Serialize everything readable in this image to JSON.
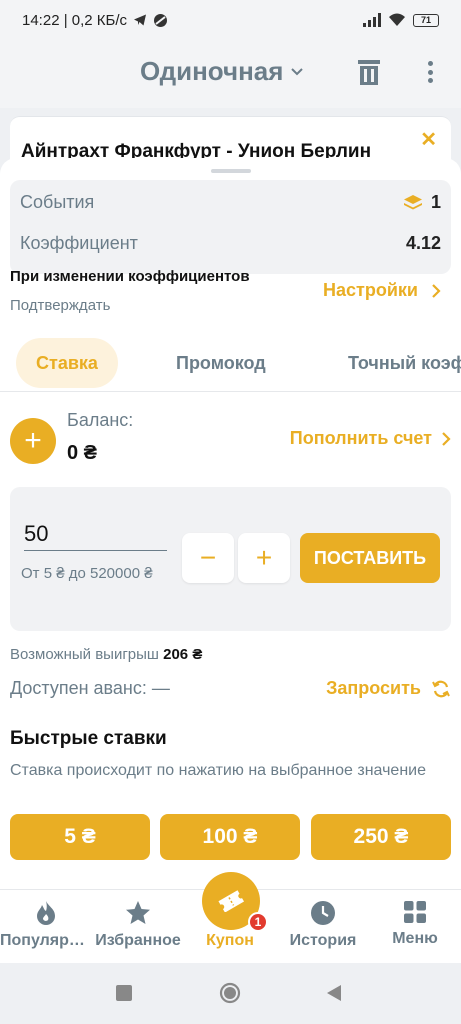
{
  "status_bar": {
    "time_speed": "14:22 | 0,2 КБ/с",
    "battery": "71"
  },
  "header": {
    "title": "Одиночная"
  },
  "match": {
    "title": "Айнтрахт Франкфурт - Унион Берлин"
  },
  "summary": {
    "events_label": "События",
    "events_value": "1",
    "coef_label": "Коэффициент",
    "coef_value": "4.12"
  },
  "odds_change": {
    "title": "При изменении коэффициентов",
    "mode": "Подтверждать",
    "settings_label": "Настройки"
  },
  "tabs": [
    {
      "label": "Ставка",
      "active": true
    },
    {
      "label": "Промокод",
      "active": false
    },
    {
      "label": "Точный коэффициент",
      "active": false
    }
  ],
  "balance": {
    "label": "Баланс:",
    "value": "0 ₴",
    "topup_label": "Пополнить счет"
  },
  "stake": {
    "amount": "50",
    "range": "От 5 ₴ до 520000 ₴",
    "minus": "−",
    "plus": "+",
    "place_label": "ПОСТАВИТЬ"
  },
  "possible_win": {
    "label": "Возможный выигрыш",
    "value": "206 ₴"
  },
  "advance": {
    "label": "Доступен аванс: —",
    "request_label": "Запросить"
  },
  "quick_bets": {
    "title": "Быстрые ставки",
    "subtitle": "Ставка происходит по нажатию на выбранное значение",
    "values": [
      "5 ₴",
      "100 ₴",
      "250 ₴"
    ]
  },
  "bottom_nav": {
    "items": [
      {
        "label": "Популярное",
        "icon": "fire-icon"
      },
      {
        "label": "Избранное",
        "icon": "star-icon"
      },
      {
        "label": "Купон",
        "icon": "ticket-icon",
        "active": true
      },
      {
        "label": "История",
        "icon": "clock-icon"
      },
      {
        "label": "Меню",
        "icon": "grid-icon"
      }
    ],
    "coupon_badge": "1"
  },
  "colors": {
    "accent": "#e9ae24",
    "muted": "#6b7d89",
    "badge": "#e23b2e"
  }
}
